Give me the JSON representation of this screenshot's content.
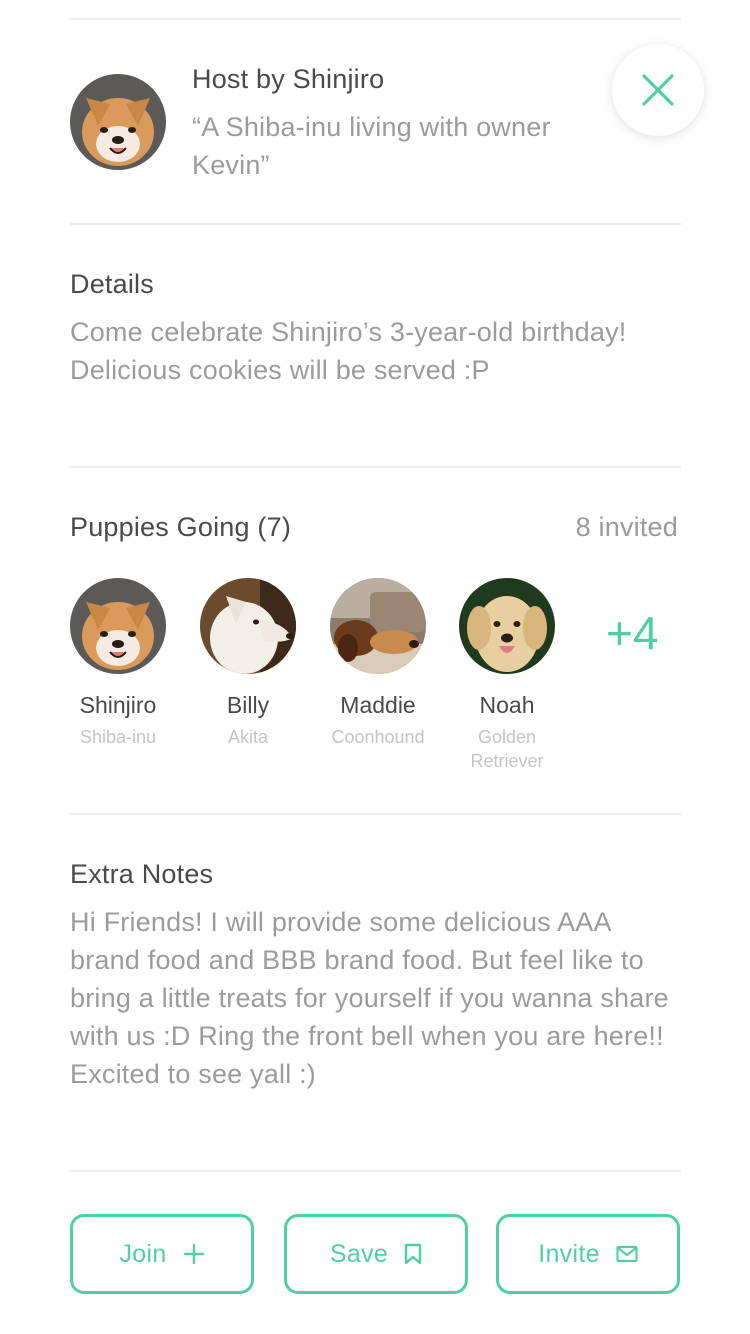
{
  "host": {
    "title": "Host by Shinjiro",
    "quote": "“A Shiba-inu living with owner Kevin”"
  },
  "details": {
    "title": "Details",
    "body": "Come celebrate Shinjiro’s 3-year-old birthday! Delicious cookies will be served :P"
  },
  "puppies": {
    "title": "Puppies Going (7)",
    "invited": "8 invited",
    "more": "+4",
    "items": [
      {
        "name": "Shinjiro",
        "breed": "Shiba-inu"
      },
      {
        "name": "Billy",
        "breed": "Akita"
      },
      {
        "name": "Maddie",
        "breed": "Coonhound"
      },
      {
        "name": "Noah",
        "breed": "Golden Retriever"
      }
    ]
  },
  "notes": {
    "title": "Extra Notes",
    "body": "Hi Friends! I will provide some delicious AAA brand food and BBB brand food. But feel like to bring a little treats for yourself if you wanna share with us :D Ring the front bell when you are here!! Excited to see yall :)"
  },
  "actions": {
    "join": "Join",
    "save": "Save",
    "invite": "Invite"
  },
  "colors": {
    "accent": "#50cfa5",
    "text_dark": "#4a4a4a",
    "text_muted": "#9b9b9b",
    "text_light": "#c4c4c4",
    "divider": "#ececec"
  },
  "icons": {
    "close": "close-icon",
    "join": "plus-icon",
    "save": "bookmark-icon",
    "invite": "mail-icon"
  }
}
